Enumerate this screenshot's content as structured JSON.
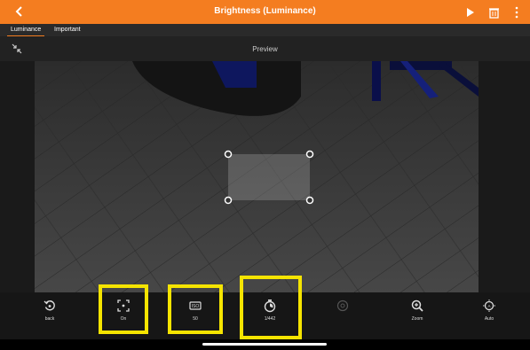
{
  "header": {
    "title": "Brightness (Luminance)",
    "back_icon": "chevron-left-icon",
    "actions": [
      "play-icon",
      "delete-icon",
      "more-vertical-icon"
    ],
    "accent_color": "#f47d20"
  },
  "tabs": [
    {
      "label": "Luminance",
      "active": true
    },
    {
      "label": "Important",
      "active": false
    }
  ],
  "preview": {
    "label": "Preview"
  },
  "controls": [
    {
      "icon": "reset-icon",
      "label": "back",
      "enabled": true
    },
    {
      "icon": "focus-icon",
      "label": "On",
      "enabled": true,
      "highlighted": true
    },
    {
      "icon": "iso-icon",
      "label": "50",
      "enabled": true,
      "highlighted": true
    },
    {
      "icon": "shutter-timer-icon",
      "label": "1/442",
      "enabled": true,
      "highlighted": true
    },
    {
      "icon": "aperture-icon",
      "label": "",
      "enabled": false
    },
    {
      "icon": "zoom-in-icon",
      "label": "Zoom",
      "enabled": true
    },
    {
      "icon": "auto-exposure-icon",
      "label": "Auto",
      "enabled": true
    }
  ],
  "highlight_color": "#f5e400"
}
